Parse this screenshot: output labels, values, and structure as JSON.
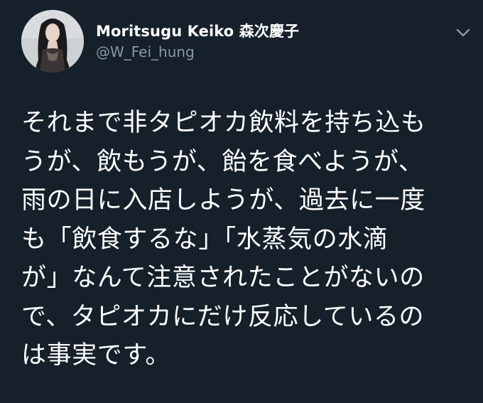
{
  "user": {
    "display_name": "Moritsugu Keiko 森次慶子",
    "handle": "@W_Fei_hung",
    "avatar_icon": "profile-photo"
  },
  "menu": {
    "icon": "chevron-down-icon"
  },
  "tweet": {
    "lines": [
      "それまで非タピオカ飲料を持ち込も",
      "うが、飲もうが、飴を食べようが、",
      "雨の日に入店しようが、過去に一度",
      "も「飲食するな」「水蒸気の水滴",
      "が」なんて注意されたことがないの",
      "で、タピオカにだけ反応しているの",
      "は事実です。"
    ]
  },
  "colors": {
    "background": "#15202b",
    "text_primary": "#ffffff",
    "text_secondary": "#8899a6"
  }
}
